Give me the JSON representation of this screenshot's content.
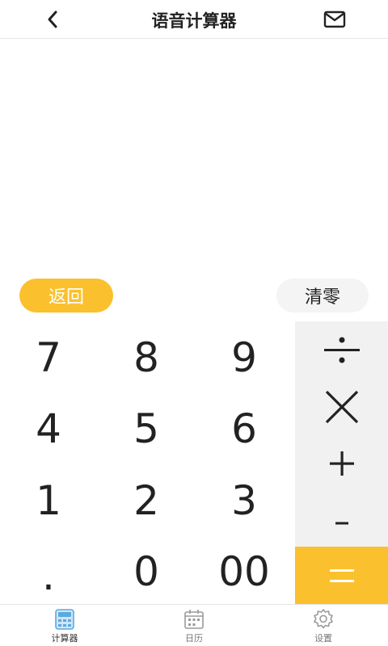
{
  "header": {
    "title": "语音计算器",
    "back_icon": "chevron-left-icon",
    "mail_icon": "mail-icon"
  },
  "display": {
    "expression": "",
    "result": ""
  },
  "controls": {
    "back_label": "返回",
    "clear_label": "清零"
  },
  "keypad": {
    "rows": [
      [
        "7",
        "8",
        "9"
      ],
      [
        "4",
        "5",
        "6"
      ],
      [
        "1",
        "2",
        "3"
      ],
      [
        ".",
        "0",
        "00"
      ]
    ],
    "operators": [
      "divide",
      "multiply",
      "plus",
      "minus",
      "equals"
    ]
  },
  "colors": {
    "accent": "#fbc02d",
    "operator_panel": "#f1f1f1",
    "text": "#222222"
  },
  "tabbar": {
    "items": [
      {
        "label": "计算器",
        "icon": "calculator-icon",
        "active": true
      },
      {
        "label": "日历",
        "icon": "calendar-icon",
        "active": false
      },
      {
        "label": "设置",
        "icon": "gear-icon",
        "active": false
      }
    ]
  }
}
